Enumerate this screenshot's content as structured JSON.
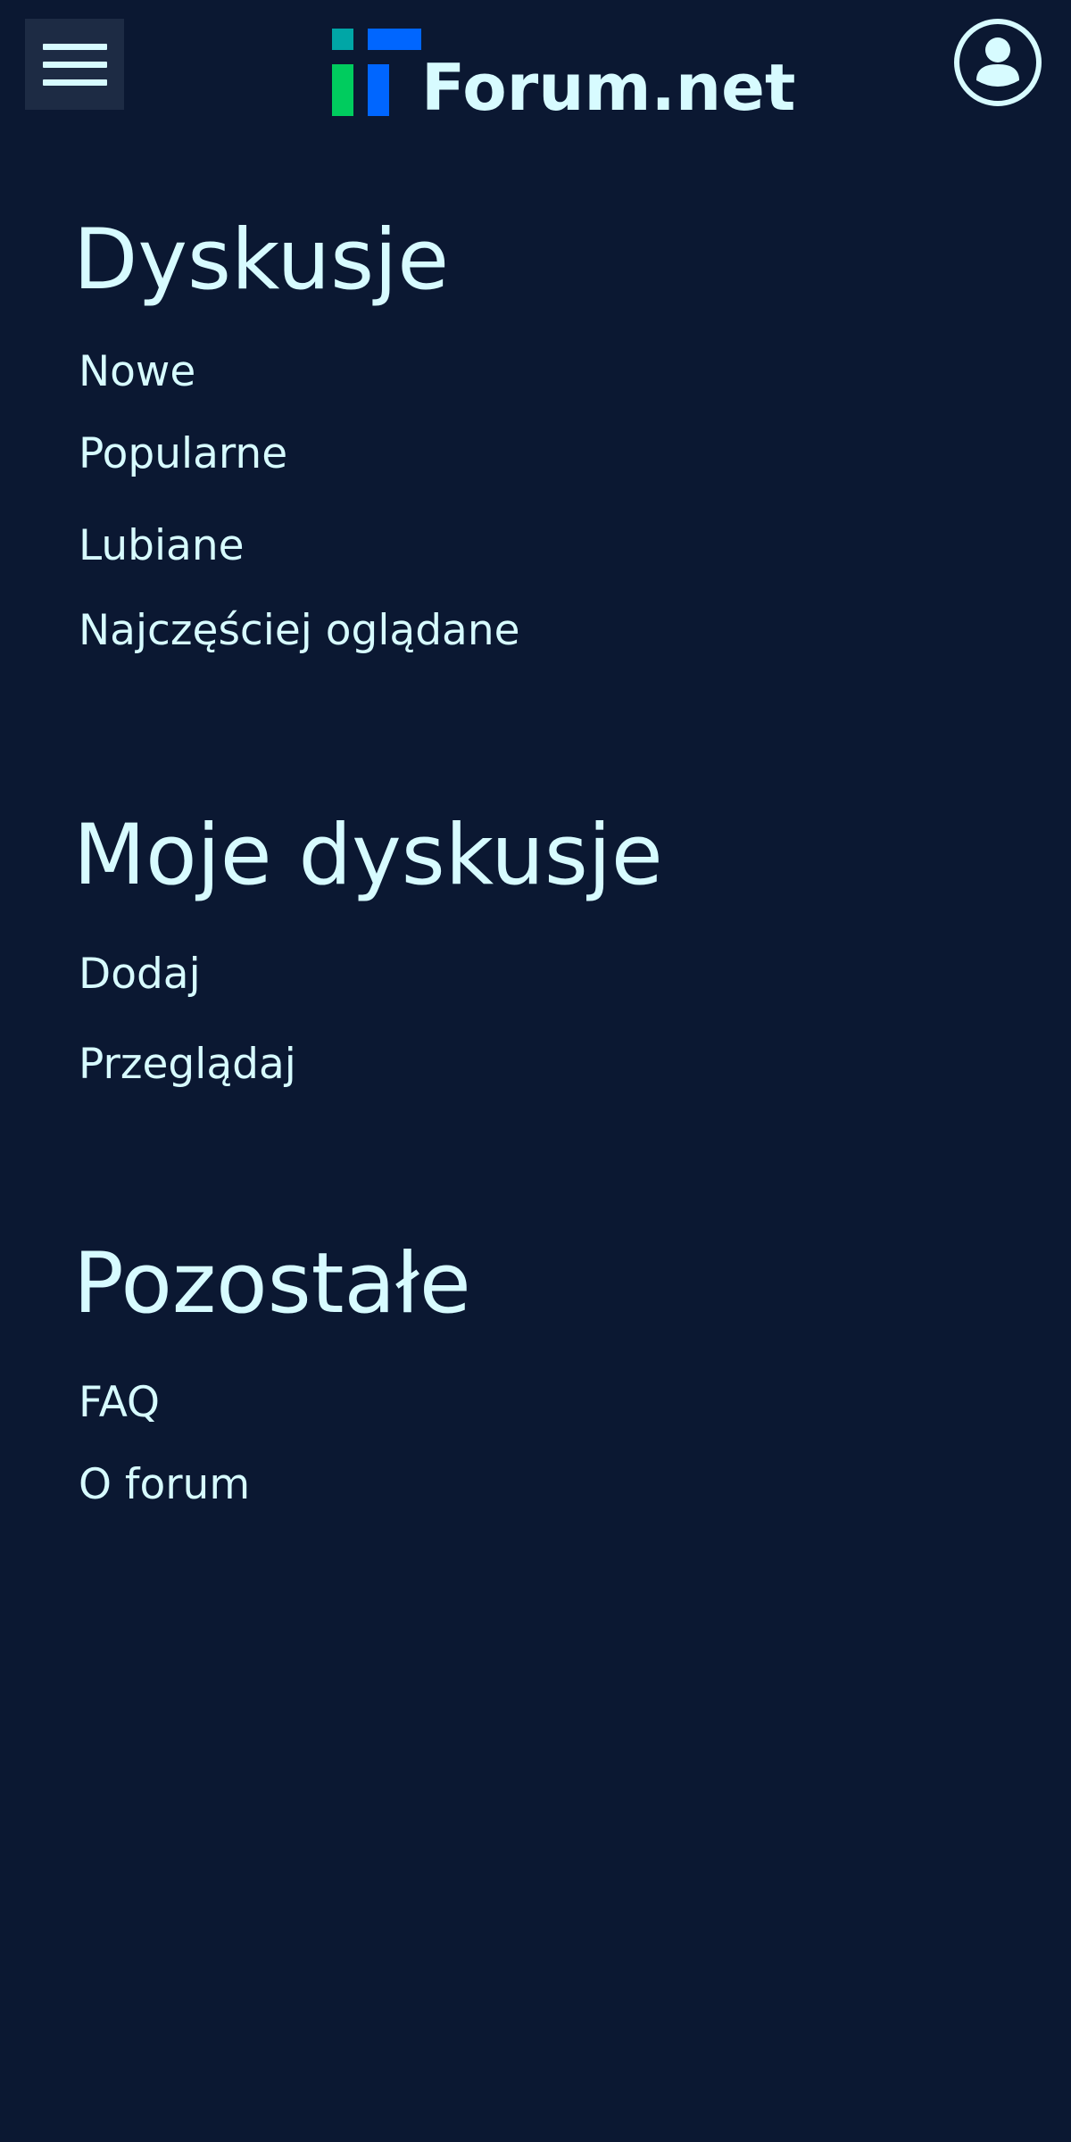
{
  "header": {
    "logo_text": "Forum.net",
    "menu_icon": "hamburger-menu-icon",
    "profile_icon": "user-avatar-icon",
    "logo_colors": {
      "teal": "#00a6a6",
      "green": "#00cc5e",
      "blue": "#0066ff"
    }
  },
  "sections": {
    "discussions": {
      "title": "Dyskusje",
      "items": [
        "Nowe",
        "Popularne",
        "Lubiane",
        "Najczęściej oglądane"
      ]
    },
    "my_discussions": {
      "title": "Moje dyskusje",
      "items": [
        "Dodaj",
        "Przeglądaj"
      ]
    },
    "other": {
      "title": "Pozostałe",
      "items": [
        "FAQ",
        "O forum"
      ]
    }
  },
  "colors": {
    "background": "#0b1832",
    "text": "#d7fbff",
    "menu_button_bg": "#1d2b44"
  }
}
